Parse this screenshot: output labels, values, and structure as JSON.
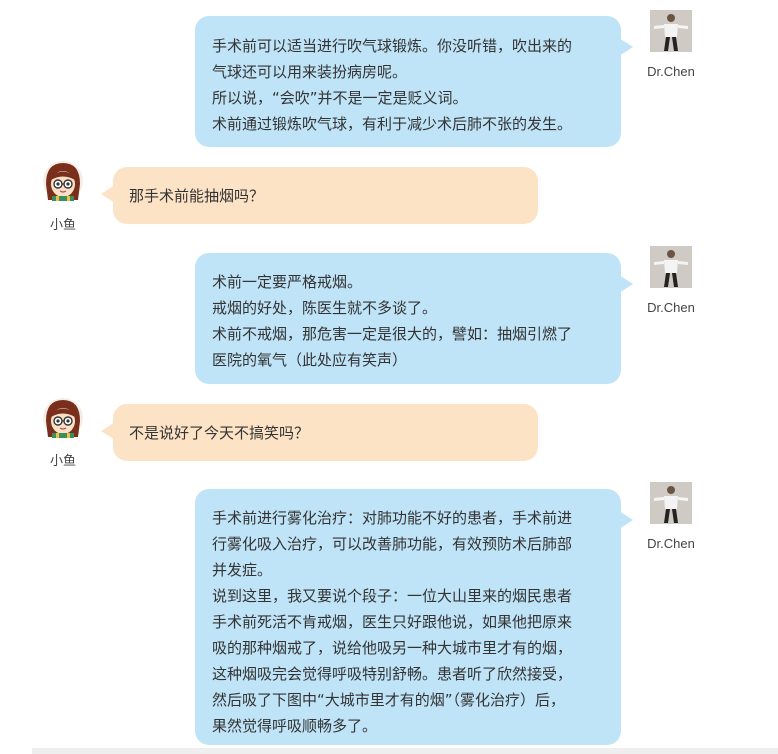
{
  "participants": {
    "doctor": {
      "name": "Dr.Chen",
      "avatar_icon": "doctor-photo-icon"
    },
    "patient": {
      "name": "小鱼",
      "avatar_icon": "girl-avatar-icon"
    }
  },
  "colors": {
    "doctor_bubble": "#bfe3f7",
    "patient_bubble": "#fde3c6",
    "text": "#333333"
  },
  "messages": [
    {
      "sender": "doctor",
      "lines": [
        "手术前可以适当进行吹气球锻炼。你没听错，吹出来的",
        "气球还可以用来装扮病房呢。",
        "所以说，“会吹”并不是一定是贬义词。",
        "术前通过锻炼吹气球，有利于减少术后肺不张的发生。"
      ]
    },
    {
      "sender": "patient",
      "lines": [
        "那手术前能抽烟吗？"
      ]
    },
    {
      "sender": "doctor",
      "lines": [
        "术前一定要严格戒烟。",
        "戒烟的好处，陈医生就不多谈了。",
        "术前不戒烟，那危害一定是很大的，譬如：抽烟引燃了",
        "医院的氧气（此处应有笑声）"
      ]
    },
    {
      "sender": "patient",
      "lines": [
        "不是说好了今天不搞笑吗？"
      ]
    },
    {
      "sender": "doctor",
      "lines": [
        "手术前进行雾化治疗：对肺功能不好的患者，手术前进",
        "行雾化吸入治疗，可以改善肺功能，有效预防术后肺部",
        "并发症。",
        "说到这里，我又要说个段子：一位大山里来的烟民患者",
        "手术前死活不肯戒烟，医生只好跟他说，如果他把原来",
        "吸的那种烟戒了，说给他吸另一种大城市里才有的烟，",
        "这种烟吸完会觉得呼吸特别舒畅。患者听了欣然接受，",
        "然后吸了下图中“大城市里才有的烟”（雾化治疗）后，",
        "果然觉得呼吸顺畅多了。"
      ]
    }
  ]
}
